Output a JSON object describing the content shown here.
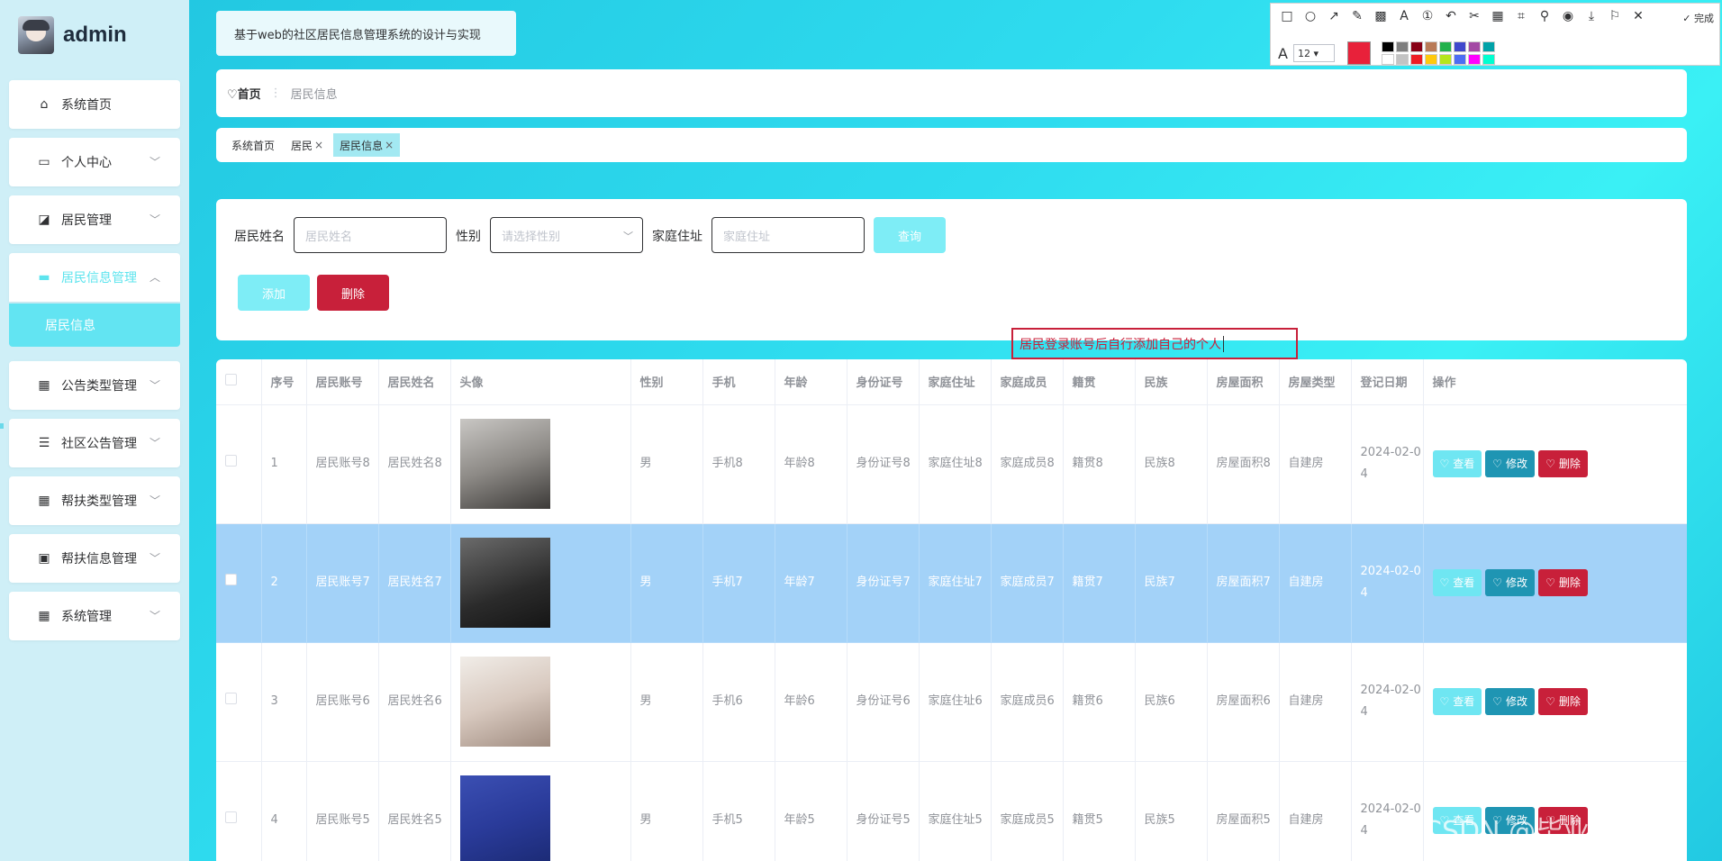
{
  "brand": {
    "name": "admin"
  },
  "sidebar": {
    "items": [
      {
        "label": "系统首页",
        "icon": "home-icon",
        "glyph": "⌂",
        "chevron": false
      },
      {
        "label": "个人中心",
        "icon": "card-icon",
        "glyph": "▭",
        "chevron": true
      },
      {
        "label": "居民管理",
        "icon": "chart-icon",
        "glyph": "◪",
        "chevron": true
      },
      {
        "label": "居民信息管理",
        "icon": "monitor-icon",
        "glyph": "▬",
        "chevron": true,
        "expanded": true
      },
      {
        "label": "公告类型管理",
        "icon": "grid-icon",
        "glyph": "▦",
        "chevron": true
      },
      {
        "label": "社区公告管理",
        "icon": "list-icon",
        "glyph": "☰",
        "chevron": true
      },
      {
        "label": "帮扶类型管理",
        "icon": "grid-icon",
        "glyph": "▦",
        "chevron": true
      },
      {
        "label": "帮扶信息管理",
        "icon": "briefcase-icon",
        "glyph": "▣",
        "chevron": true
      },
      {
        "label": "系统管理",
        "icon": "grid-icon",
        "glyph": "▦",
        "chevron": true
      }
    ],
    "sub_item": "居民信息"
  },
  "title": "基于web的社区居民信息管理系统的设计与实现",
  "breadcrumb": {
    "home": "首页",
    "current": "居民信息"
  },
  "tags": [
    {
      "label": "系统首页",
      "closable": false
    },
    {
      "label": "居民",
      "closable": true
    },
    {
      "label": "居民信息",
      "closable": true,
      "active": true
    }
  ],
  "search": {
    "name_label": "居民姓名",
    "name_placeholder": "居民姓名",
    "gender_label": "性别",
    "gender_placeholder": "请选择性别",
    "address_label": "家庭住址",
    "address_placeholder": "家庭住址",
    "query_button": "查询",
    "add_button": "添加",
    "delete_button": "删除"
  },
  "annotation": "居民登录账号后自行添加自己的个人",
  "table": {
    "headers": [
      "序号",
      "居民账号",
      "居民姓名",
      "头像",
      "性别",
      "手机",
      "年龄",
      "身份证号",
      "家庭住址",
      "家庭成员",
      "籍贯",
      "民族",
      "房屋面积",
      "房屋类型",
      "登记日期",
      "操作"
    ],
    "rows": [
      {
        "idx": "1",
        "account": "居民账号8",
        "name": "居民姓名8",
        "gender": "男",
        "phone": "手机8",
        "age": "年龄8",
        "id": "身份证号8",
        "address": "家庭住址8",
        "members": "家庭成员8",
        "native": "籍贯8",
        "ethnic": "民族8",
        "area": "房屋面积8",
        "type": "自建房",
        "date": "2024-02-04"
      },
      {
        "idx": "2",
        "account": "居民账号7",
        "name": "居民姓名7",
        "gender": "男",
        "phone": "手机7",
        "age": "年龄7",
        "id": "身份证号7",
        "address": "家庭住址7",
        "members": "家庭成员7",
        "native": "籍贯7",
        "ethnic": "民族7",
        "area": "房屋面积7",
        "type": "自建房",
        "date": "2024-02-04",
        "selected": true
      },
      {
        "idx": "3",
        "account": "居民账号6",
        "name": "居民姓名6",
        "gender": "男",
        "phone": "手机6",
        "age": "年龄6",
        "id": "身份证号6",
        "address": "家庭住址6",
        "members": "家庭成员6",
        "native": "籍贯6",
        "ethnic": "民族6",
        "area": "房屋面积6",
        "type": "自建房",
        "date": "2024-02-04"
      },
      {
        "idx": "4",
        "account": "居民账号5",
        "name": "居民姓名5",
        "gender": "男",
        "phone": "手机5",
        "age": "年龄5",
        "id": "身份证号5",
        "address": "家庭住址5",
        "members": "家庭成员5",
        "native": "籍贯5",
        "ethnic": "民族5",
        "area": "房屋面积5",
        "type": "自建房",
        "date": "2024-02-04"
      }
    ],
    "actions": {
      "view": "查看",
      "edit": "修改",
      "delete": "删除"
    }
  },
  "snip_tool": {
    "done_label": "完成",
    "font_size": "12",
    "current_color": "#e8213a"
  },
  "watermark": "CSDN @毕业程序员",
  "colors": {
    "accent": "#62e4f2",
    "danger": "#c8203a",
    "edit": "#1f95b3",
    "selected_row": "#a3d2f8"
  }
}
